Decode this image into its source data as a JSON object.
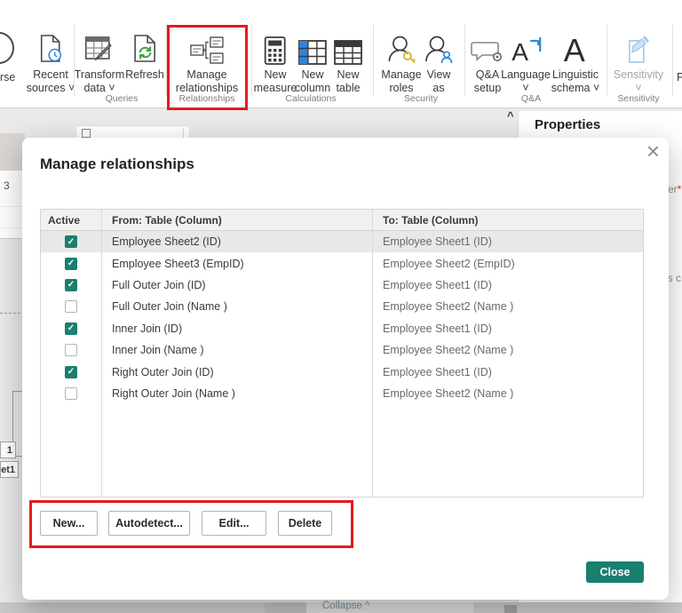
{
  "ribbon": {
    "items": [
      {
        "label1": "rse",
        "label2": ""
      },
      {
        "label1": "Recent",
        "label2": "sources ˅"
      },
      {
        "label1": "Transform",
        "label2": "data ˅"
      },
      {
        "label1": "Refresh",
        "label2": ""
      },
      {
        "label1": "Manage",
        "label2": "relationships"
      },
      {
        "label1": "New",
        "label2": "measure"
      },
      {
        "label1": "New",
        "label2": "column"
      },
      {
        "label1": "New",
        "label2": "table"
      },
      {
        "label1": "Manage",
        "label2": "roles"
      },
      {
        "label1": "View",
        "label2": "as"
      },
      {
        "label1": "Q&A",
        "label2": "setup"
      },
      {
        "label1": "Language",
        "label2": "˅"
      },
      {
        "label1": "Linguistic",
        "label2": "schema ˅"
      },
      {
        "label1": "Sensitivity",
        "label2": "˅"
      },
      {
        "label1": "P",
        "label2": ""
      }
    ],
    "group_labels": [
      "Queries",
      "Relationships",
      "Calculations",
      "Security",
      "Q&A",
      "Sensitivity"
    ]
  },
  "properties_panel": {
    "title": "Properties",
    "collapse_chevron": "^",
    "fragment_top": "er",
    "fragment_top_mark": "*",
    "fragment_bottom": "is c"
  },
  "canvas": {
    "table_card_fragment": "3",
    "table_chip_fragment_1": "1",
    "table_chip_fragment_2": "et1",
    "collapse_label": "Collapse ^"
  },
  "dialog": {
    "title": "Manage relationships",
    "close_icon": "×",
    "check_glyph": "✓",
    "table": {
      "headers": {
        "active": "Active",
        "from": "From: Table (Column)",
        "to": "To: Table (Column)"
      },
      "rows": [
        {
          "active": true,
          "selected": true,
          "from": "Employee Sheet2 (ID)",
          "to": "Employee Sheet1 (ID)"
        },
        {
          "active": true,
          "selected": false,
          "from": "Employee Sheet3 (EmpID)",
          "to": "Employee Sheet2 (EmpID)"
        },
        {
          "active": true,
          "selected": false,
          "from": "Full Outer Join (ID)",
          "to": "Employee Sheet1 (ID)"
        },
        {
          "active": false,
          "selected": false,
          "from": "Full Outer Join (Name )",
          "to": "Employee Sheet2 (Name )"
        },
        {
          "active": true,
          "selected": false,
          "from": "Inner Join (ID)",
          "to": "Employee Sheet1 (ID)"
        },
        {
          "active": false,
          "selected": false,
          "from": "Inner Join (Name )",
          "to": "Employee Sheet2 (Name )"
        },
        {
          "active": true,
          "selected": false,
          "from": "Right Outer Join (ID)",
          "to": "Employee Sheet1 (ID)"
        },
        {
          "active": false,
          "selected": false,
          "from": "Right Outer Join (Name )",
          "to": "Employee Sheet2 (Name )"
        }
      ]
    },
    "buttons": {
      "new": "New...",
      "autodetect": "Autodetect...",
      "edit": "Edit...",
      "delete": "Delete"
    },
    "close_button": "Close"
  },
  "colors": {
    "checkbox_green": "#1A8070",
    "close_teal": "#17806E",
    "annotation_red": "#E31B1C"
  }
}
